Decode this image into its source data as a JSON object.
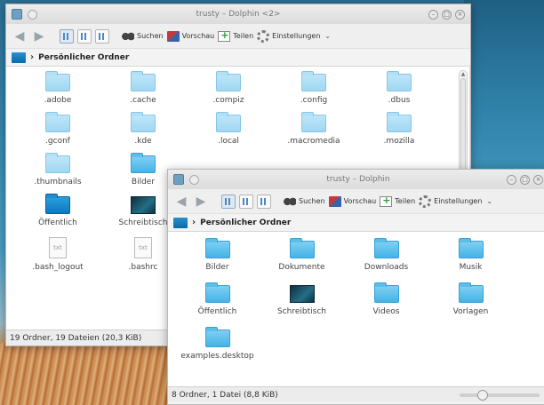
{
  "windows": {
    "back": {
      "title": "trusty – Dolphin <2>",
      "location": "Persönlicher Ordner",
      "items": [
        {
          "label": ".adobe",
          "icon": "folder-light"
        },
        {
          "label": ".cache",
          "icon": "folder-light"
        },
        {
          "label": ".compiz",
          "icon": "folder-light"
        },
        {
          "label": ".config",
          "icon": "folder-light"
        },
        {
          "label": ".dbus",
          "icon": "folder-light"
        },
        {
          "label": ".gconf",
          "icon": "folder-light"
        },
        {
          "label": ".kde",
          "icon": "folder-light"
        },
        {
          "label": ".local",
          "icon": "folder-light"
        },
        {
          "label": ".macromedia",
          "icon": "folder-light"
        },
        {
          "label": ".mozilla",
          "icon": "folder-light"
        },
        {
          "label": ".thumbnails",
          "icon": "folder-light"
        },
        {
          "label": "Bilder",
          "icon": "folder"
        },
        {
          "label": "",
          "icon": "none"
        },
        {
          "label": "",
          "icon": "none"
        },
        {
          "label": "",
          "icon": "none"
        },
        {
          "label": "Öffentlich",
          "icon": "folder-dark"
        },
        {
          "label": "Schreibtisch",
          "icon": "desktop"
        },
        {
          "label": "",
          "icon": "none"
        },
        {
          "label": "",
          "icon": "none"
        },
        {
          "label": "",
          "icon": "none"
        },
        {
          "label": ".bash_logout",
          "icon": "text-file"
        },
        {
          "label": ".bashrc",
          "icon": "text-file"
        },
        {
          "label": "",
          "icon": "none"
        },
        {
          "label": "",
          "icon": "none"
        },
        {
          "label": "",
          "icon": "none"
        }
      ],
      "status": "19 Ordner, 19 Dateien (20,3 KiB)"
    },
    "front": {
      "title": "trusty – Dolphin",
      "location": "Persönlicher Ordner",
      "items": [
        {
          "label": "Bilder",
          "icon": "folder"
        },
        {
          "label": "Dokumente",
          "icon": "folder"
        },
        {
          "label": "Downloads",
          "icon": "folder"
        },
        {
          "label": "Musik",
          "icon": "folder"
        },
        {
          "label": "",
          "icon": "none"
        },
        {
          "label": "Öffentlich",
          "icon": "folder"
        },
        {
          "label": "Schreibtisch",
          "icon": "desktop"
        },
        {
          "label": "Videos",
          "icon": "folder"
        },
        {
          "label": "Vorlagen",
          "icon": "folder"
        },
        {
          "label": "",
          "icon": "none"
        },
        {
          "label": "examples.desktop",
          "icon": "folder"
        }
      ],
      "status": "8 Ordner, 1 Datei (8,8 KiB)",
      "zoom_level": 0.25
    }
  },
  "toolbar": {
    "search_label": "Suchen",
    "preview_label": "Vorschau",
    "split_label": "Teilen",
    "settings_label": "Einstellungen",
    "more_glyph": "⌄"
  },
  "icons": {
    "back": "arrow-left-icon",
    "forward": "arrow-right-icon",
    "text_file_glyph": "txt"
  }
}
